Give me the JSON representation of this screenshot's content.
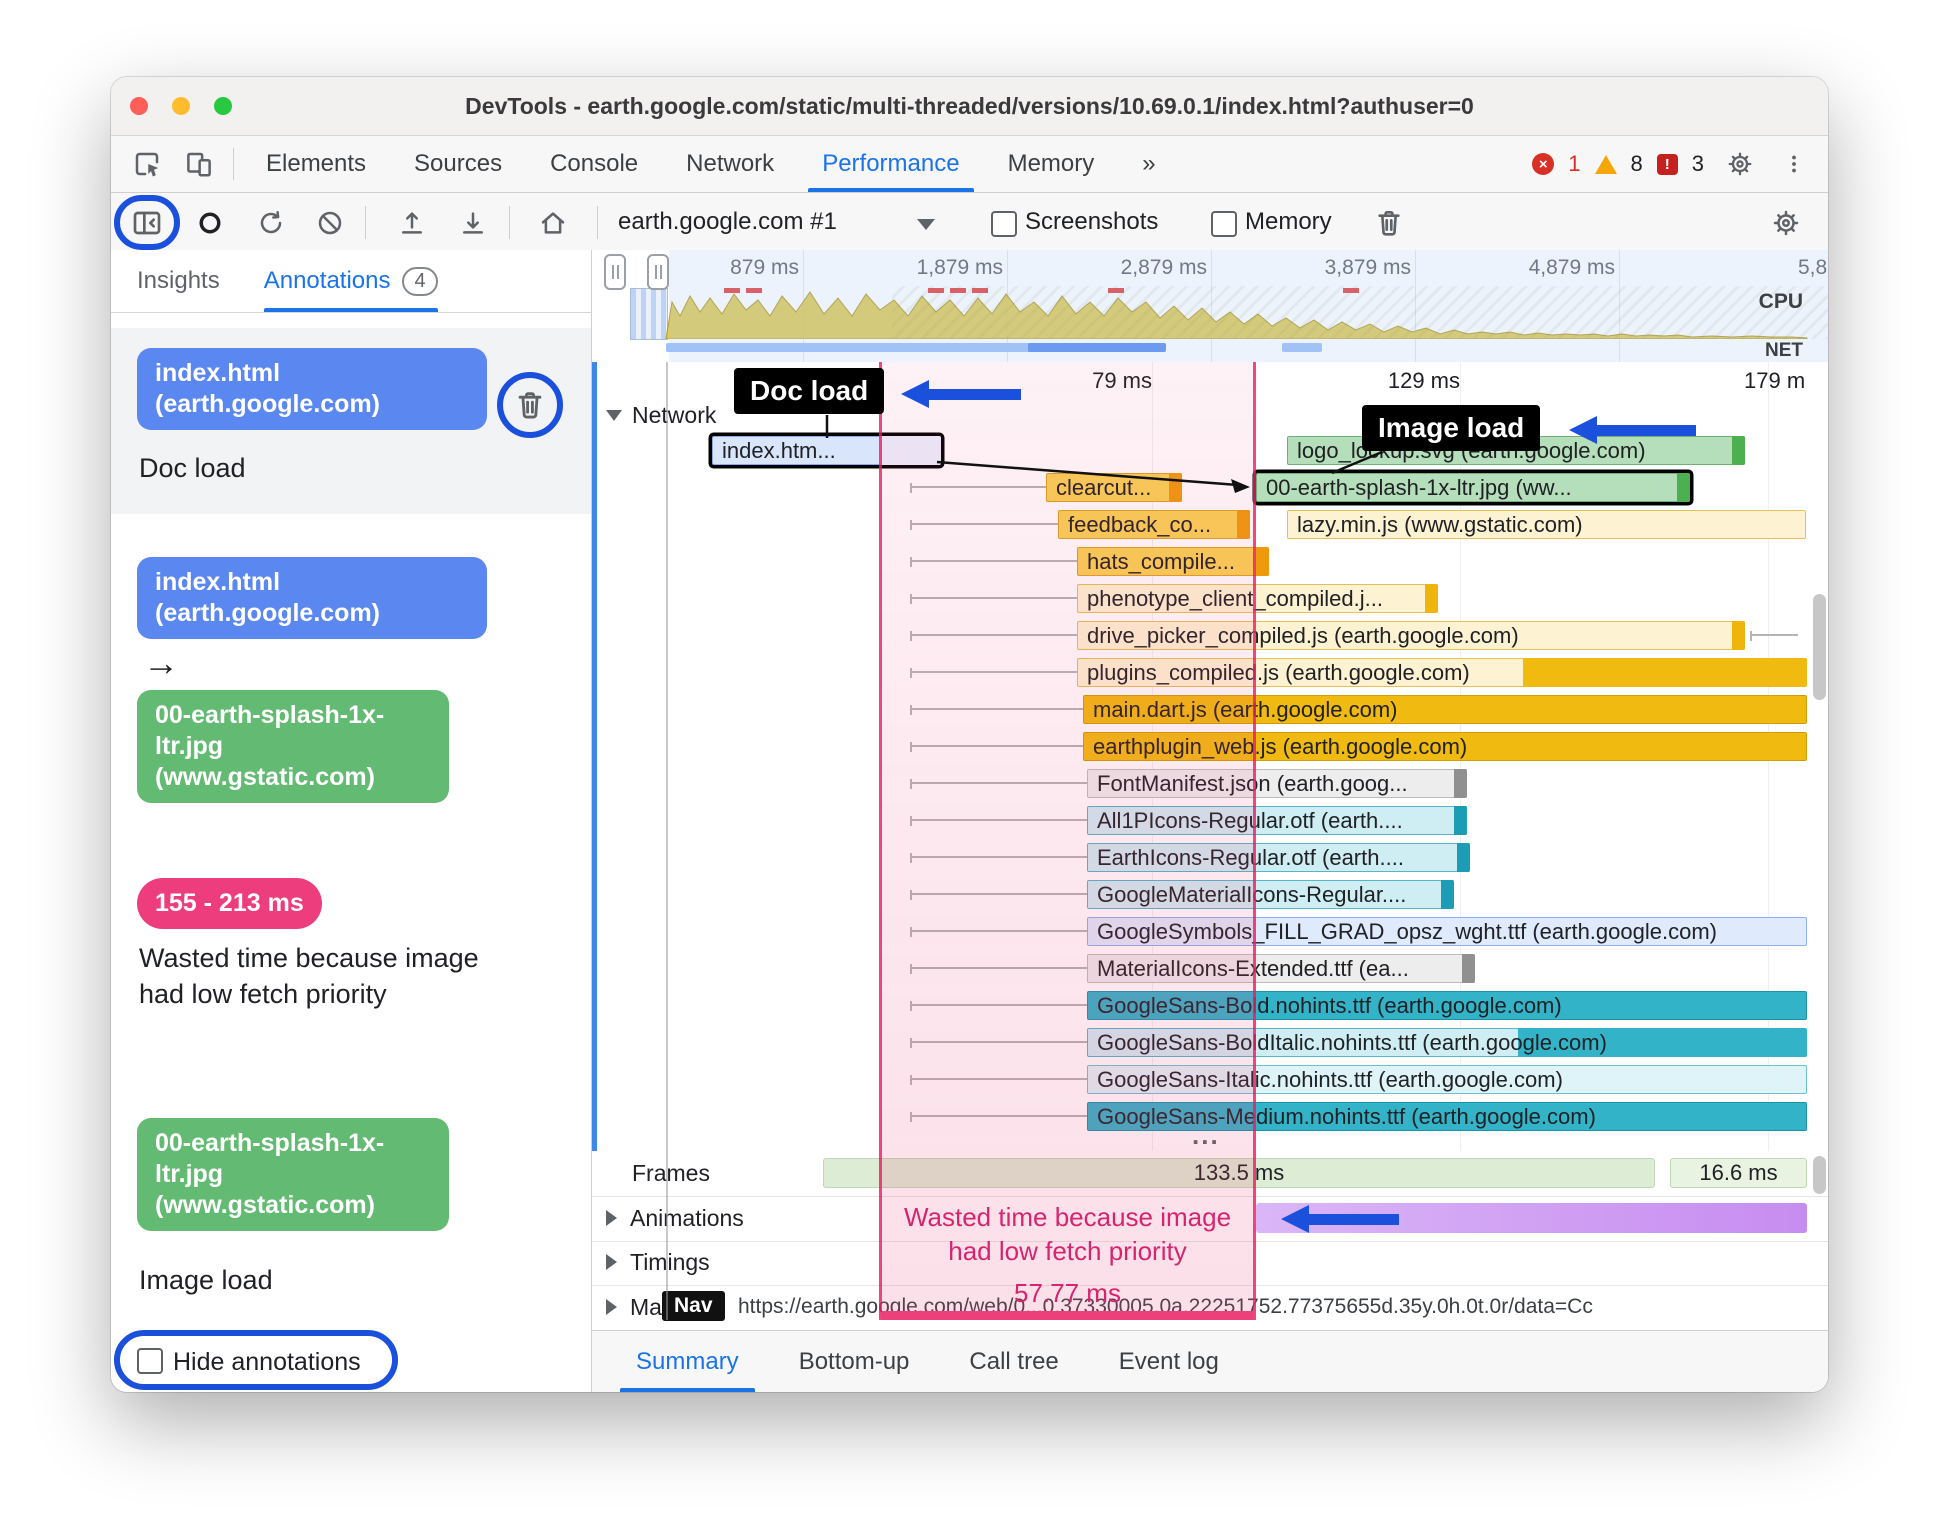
{
  "colors": {
    "accent": "#1a73e8",
    "annblue": "#1b50dd",
    "chipblue": "#5b87f0",
    "chipgreen": "#63ba72",
    "chippink": "#ee3d7c"
  },
  "titlebar": {
    "title": "DevTools - earth.google.com/static/multi-threaded/versions/10.69.0.1/index.html?authuser=0"
  },
  "tabbar": {
    "tabs": [
      "Elements",
      "Sources",
      "Console",
      "Network",
      "Performance",
      "Memory"
    ],
    "more": "»",
    "error_count": "1",
    "warning_count": "8",
    "issue_count": "3"
  },
  "toolbar": {
    "profile": "earth.google.com #1",
    "screenshots": "Screenshots",
    "memory": "Memory"
  },
  "sidebar": {
    "tab_insights": "Insights",
    "tab_annotations": "Annotations",
    "annotations_count": "4",
    "entry1": {
      "chip": "index.html (earth.google.com)",
      "label": "Doc load"
    },
    "entry2": {
      "chip_from": "index.html (earth.google.com)",
      "arrow": "→",
      "chip_to": "00-earth-splash-1x-ltr.jpg (www.gstatic.com)"
    },
    "entry3": {
      "chip": "155 - 213 ms",
      "label": "Wasted time because image had low fetch priority"
    },
    "entry4": {
      "chip": "00-earth-splash-1x-ltr.jpg (www.gstatic.com)",
      "label": "Image load"
    },
    "hide_annotations": "Hide annotations"
  },
  "minimap": {
    "ticks": [
      "879 ms",
      "1,879 ms",
      "2,879 ms",
      "3,879 ms",
      "4,879 ms",
      "5,8"
    ],
    "cpu": "CPU",
    "net": "NET"
  },
  "timeline": {
    "time_labels": [
      "79 ms",
      "129 ms",
      "179 m"
    ],
    "group": "Network",
    "overflow": "...",
    "rows": [
      {
        "label": "index.htm..."
      },
      {
        "label": "logo_lockup.svg (earth.google.com)"
      },
      {
        "label": "clearcut..."
      },
      {
        "label": "00-earth-splash-1x-ltr.jpg (ww..."
      },
      {
        "label": "feedback_co..."
      },
      {
        "label": "lazy.min.js (www.gstatic.com)"
      },
      {
        "label": "hats_compile..."
      },
      {
        "label": "phenotype_client_compiled.j..."
      },
      {
        "label": "drive_picker_compiled.js (earth.google.com)"
      },
      {
        "label": "plugins_compiled.js (earth.google.com)"
      },
      {
        "label": "main.dart.js (earth.google.com)"
      },
      {
        "label": "earthplugin_web.js (earth.google.com)"
      },
      {
        "label": "FontManifest.json (earth.goog..."
      },
      {
        "label": "All1PIcons-Regular.otf (earth...."
      },
      {
        "label": "EarthIcons-Regular.otf (earth...."
      },
      {
        "label": "GoogleMaterialIcons-Regular...."
      },
      {
        "label": "GoogleSymbols_FILL_GRAD_opsz_wght.ttf (earth.google.com)"
      },
      {
        "label": "MaterialIcons-Extended.ttf (ea..."
      },
      {
        "label": "GoogleSans-Bold.nohints.ttf (earth.google.com)"
      },
      {
        "label": "GoogleSans-BoldItalic.nohints.ttf (earth.google.com)"
      },
      {
        "label": "GoogleSans-Italic.nohints.ttf (earth.google.com)"
      },
      {
        "label": "GoogleSans-Medium.nohints.ttf (earth.google.com)"
      }
    ]
  },
  "annotations": {
    "doc_load": "Doc load",
    "image_load": "Image load",
    "wasted_text": "Wasted time because image had low fetch priority",
    "wasted_ms": "57.77 ms"
  },
  "tracks": {
    "frames": "Frames",
    "frames_ms_1": "133.5 ms",
    "frames_ms_2": "16.6 ms",
    "animations": "Animations",
    "timings": "Timings",
    "main": "Ma",
    "nav": "Nav",
    "url": "https://earth.google.com/web/0...0.37330005.0a.22251752.77375655d.35y.0h.0t.0r/data=Cc"
  },
  "bottom_tabs": [
    "Summary",
    "Bottom-up",
    "Call tree",
    "Event log"
  ]
}
